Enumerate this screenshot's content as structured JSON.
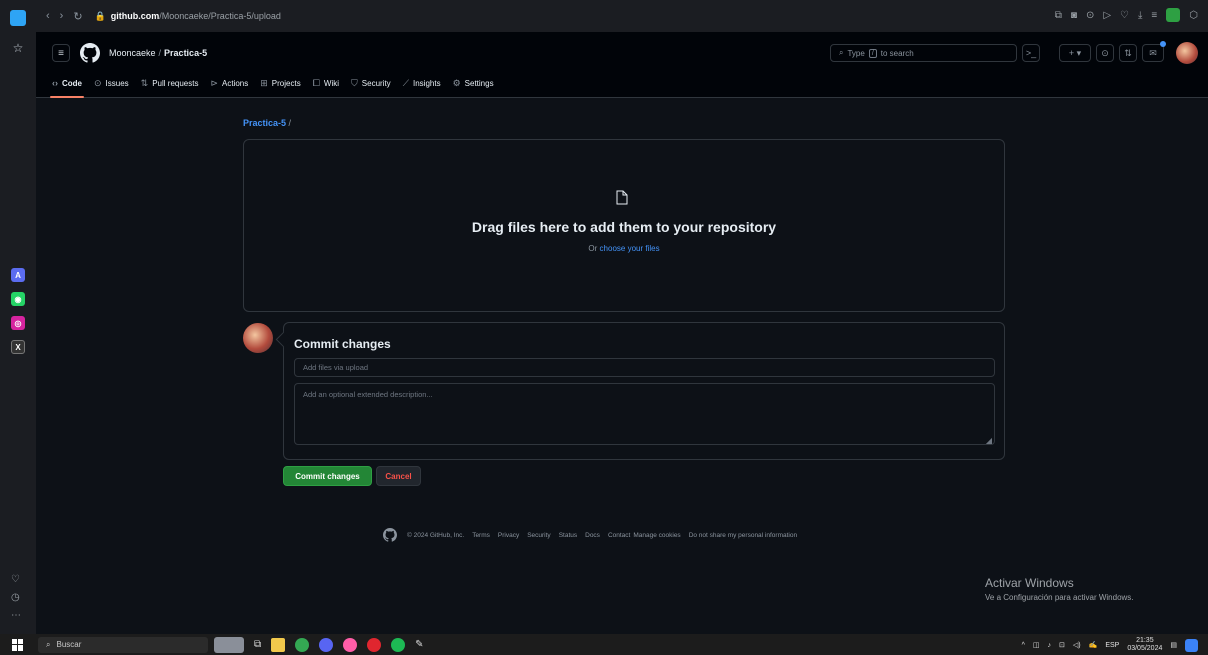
{
  "browser": {
    "url_host": "github.com",
    "url_path": "/Mooncaeke/Practica-5/upload"
  },
  "header": {
    "owner": "Mooncaeke",
    "separator": "/",
    "repo": "Practica-5",
    "search_placeholder_prefix": "Type",
    "search_key": "/",
    "search_placeholder_suffix": "to search"
  },
  "tabs": [
    {
      "label": "Code",
      "icon": "code-icon"
    },
    {
      "label": "Issues",
      "icon": "issue-icon"
    },
    {
      "label": "Pull requests",
      "icon": "pull-request-icon"
    },
    {
      "label": "Actions",
      "icon": "play-icon"
    },
    {
      "label": "Projects",
      "icon": "table-icon"
    },
    {
      "label": "Wiki",
      "icon": "book-icon"
    },
    {
      "label": "Security",
      "icon": "shield-icon"
    },
    {
      "label": "Insights",
      "icon": "graph-icon"
    },
    {
      "label": "Settings",
      "icon": "gear-icon"
    }
  ],
  "main": {
    "repo_link": "Practica-5",
    "repo_slash": "/",
    "drop_title": "Drag files here to add them to your repository",
    "drop_or": "Or",
    "drop_choose": "choose your files"
  },
  "commit": {
    "title": "Commit changes",
    "summary_placeholder": "Add files via upload",
    "description_placeholder": "Add an optional extended description...",
    "commit_button": "Commit changes",
    "cancel_button": "Cancel"
  },
  "footer": {
    "copyright": "© 2024 GitHub, Inc.",
    "links": [
      "Terms",
      "Privacy",
      "Security",
      "Status",
      "Docs",
      "Contact",
      "Manage cookies",
      "Do not share my personal information"
    ]
  },
  "watermark": {
    "title": "Activar Windows",
    "subtitle": "Ve a Configuración para activar Windows."
  },
  "taskbar": {
    "search_label": "Buscar",
    "language": "ESP",
    "time": "21:35",
    "date": "03/05/2024"
  },
  "colors": {
    "accent_blue": "#4493f8",
    "commit_green": "#238636",
    "cancel_red": "#f85149",
    "active_tab_underline": "#f78166"
  }
}
